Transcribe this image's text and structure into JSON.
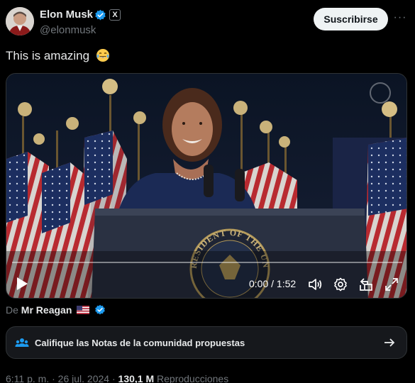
{
  "header": {
    "name": "Elon Musk",
    "handle": "@elonmusk",
    "badge_label": "X",
    "subscribe_label": "Suscribirse",
    "more_label": "···"
  },
  "tweet": {
    "text": "This is amazing",
    "emoji": "face-with-tears-of-joy"
  },
  "video": {
    "current_time": "0:00",
    "separator": " / ",
    "duration": "1:52",
    "progress": 0.0,
    "podium_seal_text": "RESIDENT OF THE UNIT"
  },
  "attribution": {
    "prefix": "De",
    "source": "Mr Reagan"
  },
  "community_notes": {
    "label": "Califique las Notas de la comunidad propuestas"
  },
  "meta": {
    "time": "6:11 p. m.",
    "dot": " · ",
    "date": "26 jul. 2024",
    "dot2": " · ",
    "views": "130,1 M",
    "views_label": "Reproducciones"
  },
  "colors": {
    "verified_blue": "#1d9bf0",
    "background": "#000000",
    "secondary_text": "#71767b"
  }
}
